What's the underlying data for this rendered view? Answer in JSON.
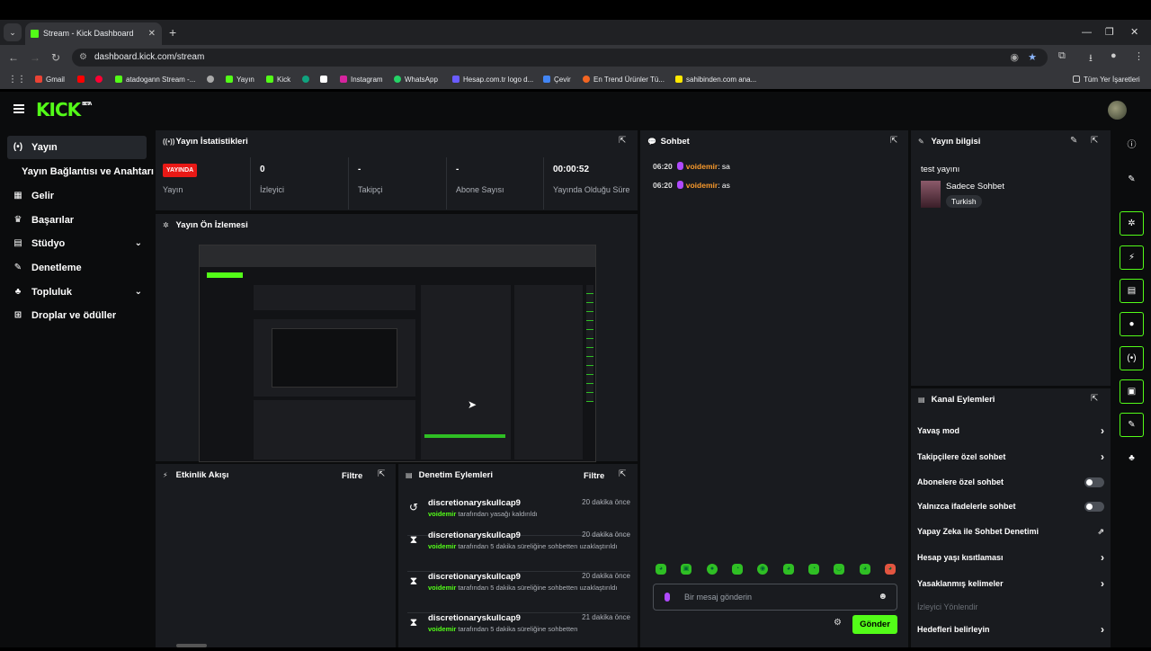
{
  "browser": {
    "tab_title": "Stream - Kick Dashboard",
    "url": "dashboard.kick.com/stream",
    "bookmarks": [
      "Gmail",
      "atadogann Stream -...",
      "Yayın",
      "Kick",
      "Instagram",
      "WhatsApp",
      "Hesap.com.tr logo d...",
      "Çevir",
      "En Trend Ürünler Tü...",
      "sahibinden.com ana..."
    ],
    "all_bookmarks": "Tüm Yer İşaretleri"
  },
  "brand": {
    "logo": "KICK",
    "badge": "BETA",
    "accent": "#53fc18"
  },
  "sidebar": {
    "items": [
      {
        "label": "Yayın",
        "icon": "broadcast-icon"
      },
      {
        "label": "Yayın Bağlantısı ve Anahtarı"
      },
      {
        "label": "Gelir",
        "icon": "chart-icon"
      },
      {
        "label": "Başarılar",
        "icon": "trophy-icon"
      },
      {
        "label": "Stüdyo",
        "icon": "studio-icon"
      },
      {
        "label": "Denetleme",
        "icon": "wrench-icon"
      },
      {
        "label": "Topluluk",
        "icon": "community-icon"
      },
      {
        "label": "Droplar ve ödüller",
        "icon": "gift-icon"
      }
    ]
  },
  "stats": {
    "title": "Yayın İstatistikleri",
    "live_badge": "YAYINDA",
    "items": [
      {
        "value": "",
        "label": "Yayın"
      },
      {
        "value": "0",
        "label": "İzleyici"
      },
      {
        "value": "-",
        "label": "Takipçi"
      },
      {
        "value": "-",
        "label": "Abone Sayısı"
      },
      {
        "value": "00:00:52",
        "label": "Yayında Olduğu Süre"
      }
    ]
  },
  "preview": {
    "title": "Yayın Ön İzlemesi"
  },
  "activity": {
    "title": "Etkinlik Akışı",
    "filter": "Filtre"
  },
  "moderation": {
    "title": "Denetim Eylemleri",
    "filter": "Filtre",
    "rows": [
      {
        "user": "discretionaryskullcap9",
        "time": "20 dakika önce",
        "mod": "voidemir",
        "text": "tarafından yasağı kaldırıldı"
      },
      {
        "user": "discretionaryskullcap9",
        "time": "20 dakika önce",
        "mod": "voidemir",
        "text": "tarafından 5 dakika süreliğine sohbetten uzaklaştırıldı"
      },
      {
        "user": "discretionaryskullcap9",
        "time": "20 dakika önce",
        "mod": "voidemir",
        "text": "tarafından 5 dakika süreliğine sohbetten uzaklaştırıldı"
      },
      {
        "user": "discretionaryskullcap9",
        "time": "21 dakika önce",
        "mod": "voidemir",
        "text": "tarafından 5 dakika süreliğine sohbetten"
      }
    ]
  },
  "chat": {
    "title": "Sohbet",
    "messages": [
      {
        "time": "06:20",
        "user": "voidemir",
        "text": ": sa"
      },
      {
        "time": "06:20",
        "user": "voidemir",
        "text": ": as"
      }
    ],
    "placeholder": "Bir mesaj gönderin",
    "send": "Gönder"
  },
  "info": {
    "title": "Yayın bilgisi",
    "stream_title": "test yayını",
    "category": "Sadece Sohbet",
    "language": "Turkish"
  },
  "actions": {
    "title": "Kanal Eylemleri",
    "rows": [
      {
        "label": "Yavaş mod",
        "kind": "arrow"
      },
      {
        "label": "Takipçilere özel sohbet",
        "kind": "arrow"
      },
      {
        "label": "Abonelere özel sohbet",
        "kind": "toggle"
      },
      {
        "label": "Yalnızca ifadelerle sohbet",
        "kind": "toggle"
      },
      {
        "label": "Yapay Zeka ile Sohbet Denetimi",
        "kind": "external"
      },
      {
        "label": "Hesap yaşı kısıtlaması",
        "kind": "arrow"
      },
      {
        "label": "Yasaklanmış kelimeler",
        "kind": "arrow"
      },
      {
        "label": "İzleyici Yönlendir",
        "kind": "muted"
      },
      {
        "label": "Hedefleri belirleyin",
        "kind": "arrow"
      }
    ]
  }
}
